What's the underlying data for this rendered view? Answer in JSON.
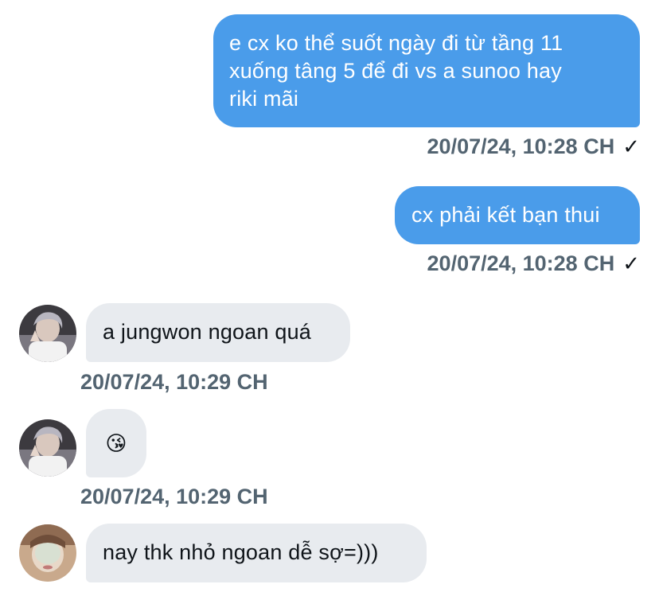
{
  "conversation": {
    "messages": [
      {
        "direction": "outgoing",
        "text": "e cx ko thể suốt ngày đi từ tầng 11 xuống tâng 5 để đi vs a sunoo hay riki mãi",
        "lines": [
          "e cx ko thể suốt ngày đi từ tầng 11",
          "xuống tâng 5 để đi vs a sunoo hay",
          "riki mãi"
        ],
        "timestamp": "20/07/24, 10:28 CH",
        "status_icon": "check-icon",
        "status_glyph": "✓"
      },
      {
        "direction": "outgoing",
        "text": "cx phải kết bạn thui",
        "timestamp": "20/07/24, 10:28 CH",
        "status_icon": "check-icon",
        "status_glyph": "✓"
      },
      {
        "direction": "incoming",
        "avatar": "user-avatar-photo",
        "text": "a jungwon ngoan quá",
        "timestamp": "20/07/24, 10:29 CH"
      },
      {
        "direction": "incoming",
        "avatar": "user-avatar-photo",
        "text": "😘",
        "timestamp": "20/07/24, 10:29 CH"
      },
      {
        "direction": "incoming",
        "avatar": "user-avatar-photo-2",
        "text": "nay thk nhỏ ngoan dễ sợ=)))"
      }
    ]
  },
  "colors": {
    "outgoing_bubble": "#4a9cea",
    "incoming_bubble": "#e8ebef",
    "timestamp_text": "#536471",
    "incoming_text": "#0f1419"
  }
}
